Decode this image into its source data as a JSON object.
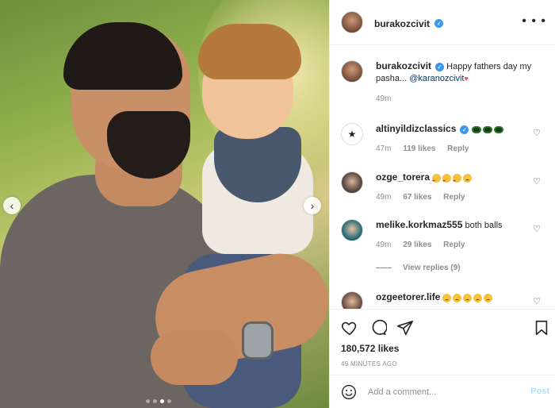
{
  "post": {
    "author": "burakozcivit",
    "caption_text": "Happy fathers day my pasha... ",
    "caption_mention": "@karanozcivit",
    "caption_age": "49m"
  },
  "comments": [
    {
      "username": "altinyildizclassics",
      "text": "",
      "emojis": [
        "shades",
        "shades",
        "shades"
      ],
      "age": "47m",
      "likes": "119 likes",
      "reply": "Reply",
      "avatar_color": "#ffffff"
    },
    {
      "username": "ozge_torera",
      "text": "",
      "emojis": [
        "hearteyes",
        "hearteyes",
        "hearteyes",
        "sad"
      ],
      "age": "49m",
      "likes": "67 likes",
      "reply": "Reply",
      "avatar_color": "#5b4a44"
    },
    {
      "username": "melike.korkmaz555",
      "text": "both balls",
      "emojis": [],
      "age": "49m",
      "likes": "29 likes",
      "reply": "Reply",
      "avatar_color": "#2e6f7a"
    },
    {
      "username": "ozgeetorer.life",
      "text": "",
      "emojis": [
        "sad",
        "sad",
        "sad",
        "sad",
        "sad"
      ],
      "age": "",
      "likes": "",
      "reply": "",
      "avatar_color": "#6d5148"
    }
  ],
  "view_replies": "View replies (9)",
  "stats": {
    "likes": "180,572 likes",
    "time": "49 MINUTES AGO"
  },
  "add_comment": {
    "placeholder": "Add a comment...",
    "post_label": "Post"
  },
  "icons": {
    "prev": "chevron-left-icon",
    "next": "chevron-right-icon",
    "like": "heart-outline-icon",
    "comment": "comment-bubble-icon",
    "share": "paper-plane-icon",
    "save": "bookmark-icon",
    "more": "ellipsis-icon",
    "emoji": "smiley-icon"
  },
  "colors": {
    "verified": "#3897f0",
    "post_button_disabled": "#b2dffc",
    "muted_text": "#8e8e8e"
  },
  "carousel": {
    "total": 4,
    "active": 3
  }
}
